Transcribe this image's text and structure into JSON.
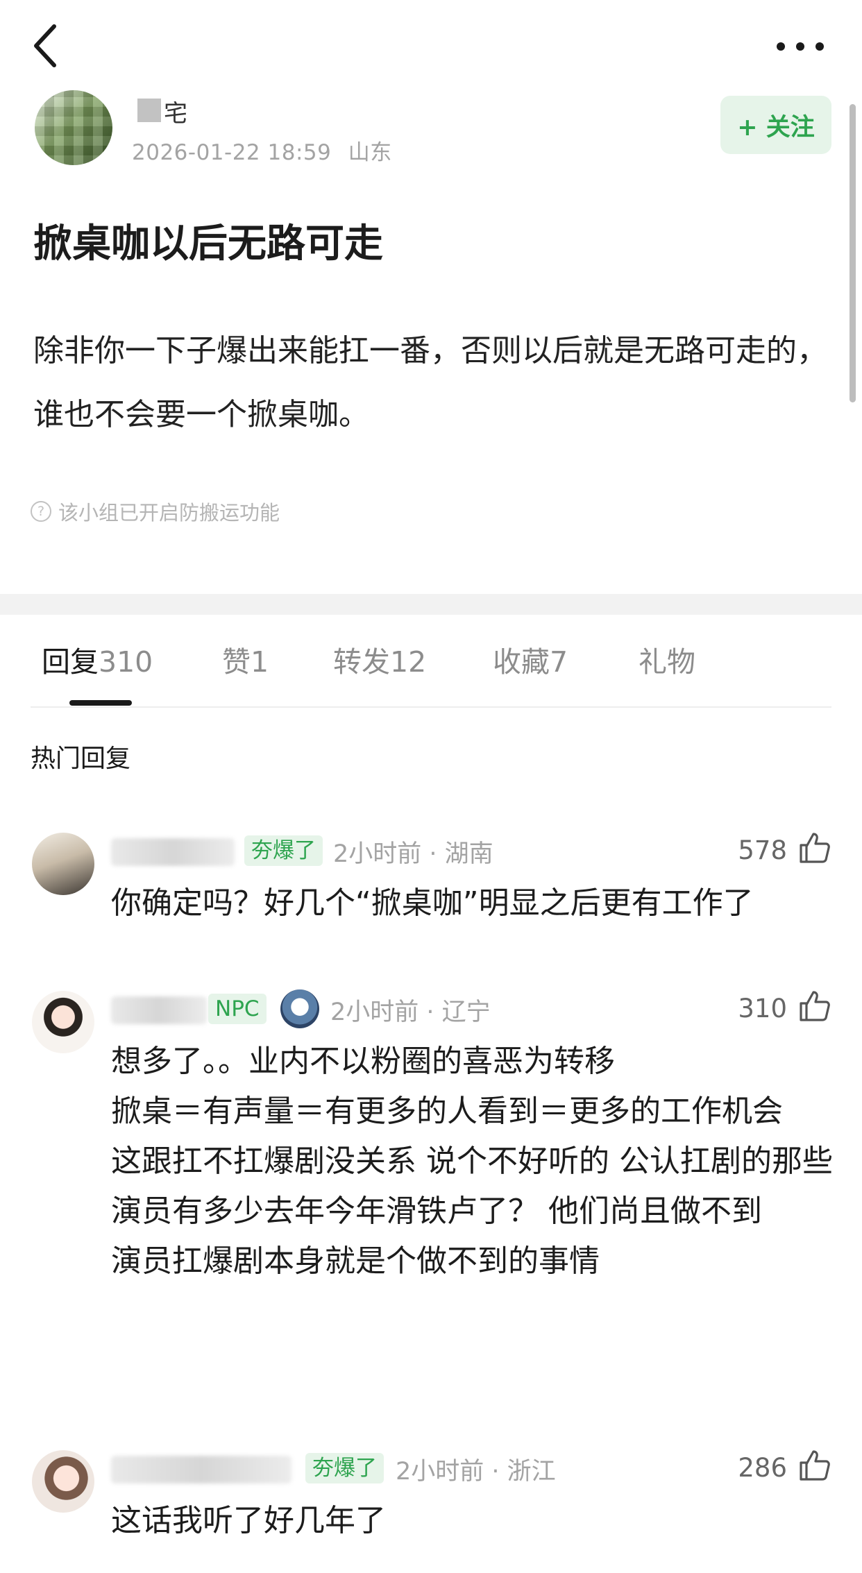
{
  "nav": {
    "back_icon": "chevron-left-icon",
    "more_icon": "more-horizontal-icon"
  },
  "author": {
    "name_visible": "宅",
    "timestamp": "2026-01-22 18:59",
    "location": "山东",
    "follow_label": "+ 关注"
  },
  "post": {
    "title": "掀桌咖以后无路可走",
    "body": "除非你一下子爆出来能扛一番，否则以后就是无路可走的，谁也不会要一个掀桌咖。",
    "notice": "该小组已开启防搬运功能"
  },
  "tabs": [
    {
      "label": "回复",
      "count": "310"
    },
    {
      "label": "赞",
      "count": "1"
    },
    {
      "label": "转发",
      "count": "12"
    },
    {
      "label": "收藏",
      "count": "7"
    },
    {
      "label": "礼物",
      "count": ""
    }
  ],
  "hot_label": "热门回复",
  "comments": [
    {
      "badge": "夯爆了",
      "time": "2小时前",
      "region": "湖南",
      "likes": "578",
      "text": "你确定吗？好几个“掀桌咖”明显之后更有工作了"
    },
    {
      "badge": "NPC",
      "time": "2小时前",
      "region": "辽宁",
      "likes": "310",
      "lines": [
        "想多了。。业内不以粉圈的喜恶为转移",
        "掀桌＝有声量＝有更多的人看到＝更多的工作机会",
        "这跟扛不扛爆剧没关系 说个不好听的 公认扛剧的那些演员有多少去年今年滑铁卢了？ 他们尚且做不到",
        "演员扛爆剧本身就是个做不到的事情"
      ]
    },
    {
      "badge": "夯爆了",
      "time": "2小时前",
      "region": "浙江",
      "likes": "286",
      "text": "这话我听了好几年了"
    }
  ],
  "colors": {
    "accent_green": "#2ea44f",
    "badge_bg": "#e6f4e9",
    "meta_gray": "#a3a3a3"
  }
}
